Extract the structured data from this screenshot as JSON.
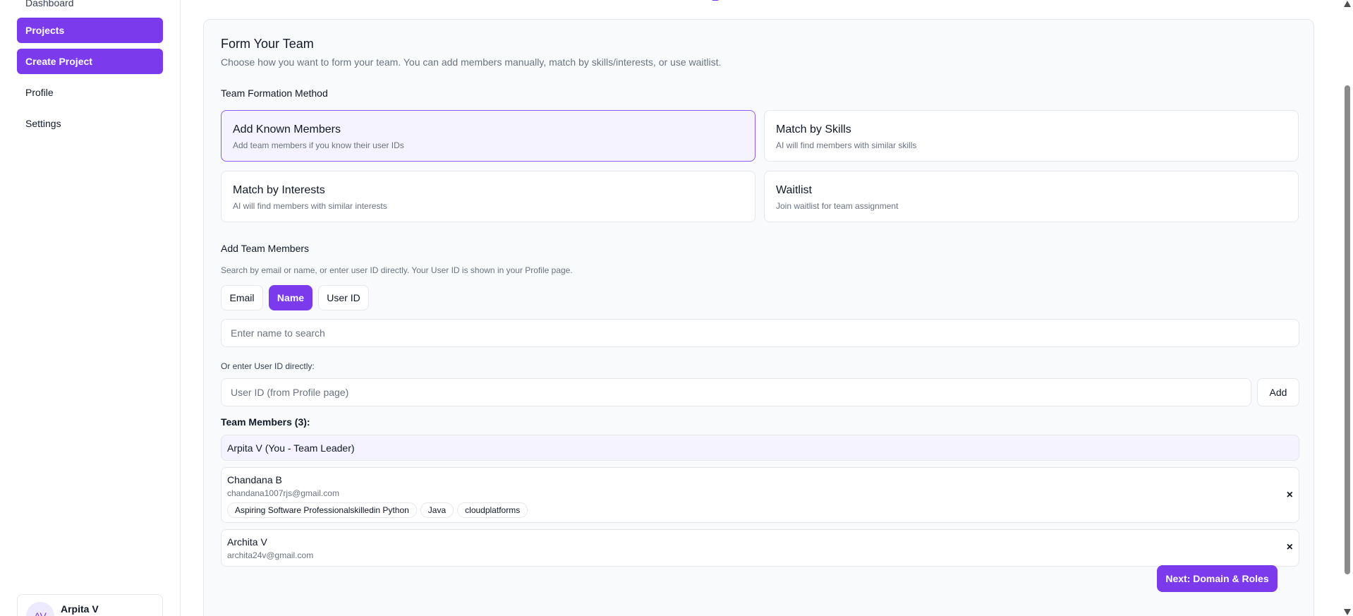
{
  "sidebar": {
    "items": [
      {
        "label": "Dashboard"
      },
      {
        "label": "Projects"
      },
      {
        "label": "Create Project"
      },
      {
        "label": "Profile"
      },
      {
        "label": "Settings"
      }
    ],
    "user": {
      "initials": "AV",
      "name": "Arpita V"
    }
  },
  "form": {
    "title": "Form Your Team",
    "subtitle": "Choose how you want to form your team. You can add members manually, match by skills/interests, or use waitlist.",
    "method_label": "Team Formation Method",
    "methods": [
      {
        "title": "Add Known Members",
        "desc": "Add team members if you know their user IDs",
        "selected": true
      },
      {
        "title": "Match by Skills",
        "desc": "AI will find members with similar skills",
        "selected": false
      },
      {
        "title": "Match by Interests",
        "desc": "AI will find members with similar interests",
        "selected": false
      },
      {
        "title": "Waitlist",
        "desc": "Join waitlist for team assignment",
        "selected": false
      }
    ],
    "add_members_label": "Add Team Members",
    "add_members_help": "Search by email or name, or enter user ID directly. Your User ID is shown in your Profile page.",
    "search_modes": [
      {
        "label": "Email",
        "active": false
      },
      {
        "label": "Name",
        "active": true
      },
      {
        "label": "User ID",
        "active": false
      }
    ],
    "search_placeholder": "Enter name to search",
    "userid_label": "Or enter User ID directly:",
    "userid_placeholder": "User ID (from Profile page)",
    "add_label": "Add",
    "team_heading": "Team Members (3):",
    "members": [
      {
        "name": "Arpita V (You - Team Leader)"
      },
      {
        "name": "Chandana B",
        "email": "chandana1007rjs@gmail.com",
        "tags": [
          "Aspiring Software Professionalskilledin Python",
          "Java",
          "cloudplatforms"
        ]
      },
      {
        "name": "Archita V",
        "email": "archita24v@gmail.com"
      }
    ],
    "remove_symbol": "×",
    "next_label": "Next: Domain & Roles"
  },
  "colors": {
    "accent": "#7c3aed",
    "accent_light": "#f5f3ff",
    "border": "#e5e7eb",
    "muted_text": "#6b7280"
  }
}
